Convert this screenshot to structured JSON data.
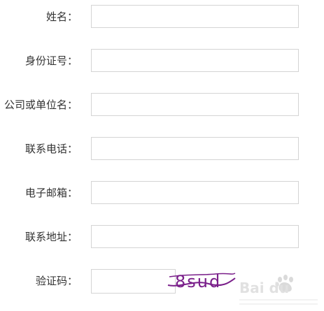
{
  "form": {
    "fields": [
      {
        "label": "姓名：",
        "value": ""
      },
      {
        "label": "身份证号：",
        "value": ""
      },
      {
        "label": "公司或单位名：",
        "value": ""
      },
      {
        "label": "联系电话：",
        "value": ""
      },
      {
        "label": "电子邮箱：",
        "value": ""
      },
      {
        "label": "联系地址：",
        "value": ""
      }
    ],
    "captcha": {
      "label": "验证码：",
      "value": "",
      "image_text": "8sud",
      "color": "#7a1f8a"
    }
  },
  "watermark": {
    "brand_text": "Bai du",
    "brand_color": "#c9c9c9"
  }
}
